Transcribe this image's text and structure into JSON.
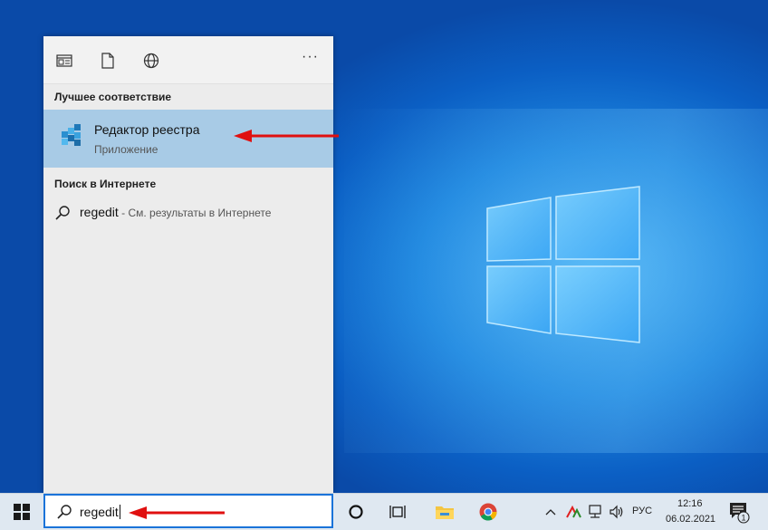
{
  "search_panel": {
    "top_icons": [
      "apps-icon",
      "document-icon",
      "web-icon"
    ],
    "more_label": "···",
    "best_match_title": "Лучшее соответствие",
    "best_match": {
      "name": "Редактор реестра",
      "type": "Приложение",
      "icon": "registry-editor-icon"
    },
    "web_title": "Поиск в Интернете",
    "web_result": {
      "query": "regedit",
      "suffix": " - См. результаты в Интернете"
    }
  },
  "taskbar": {
    "search_value": "regedit",
    "language": "РУС",
    "time": "12:16",
    "date": "06.02.2021",
    "notification_count": "1"
  },
  "colors": {
    "selection": "#a8cbe6",
    "accent": "#1a73d9",
    "arrow": "#e01010"
  }
}
